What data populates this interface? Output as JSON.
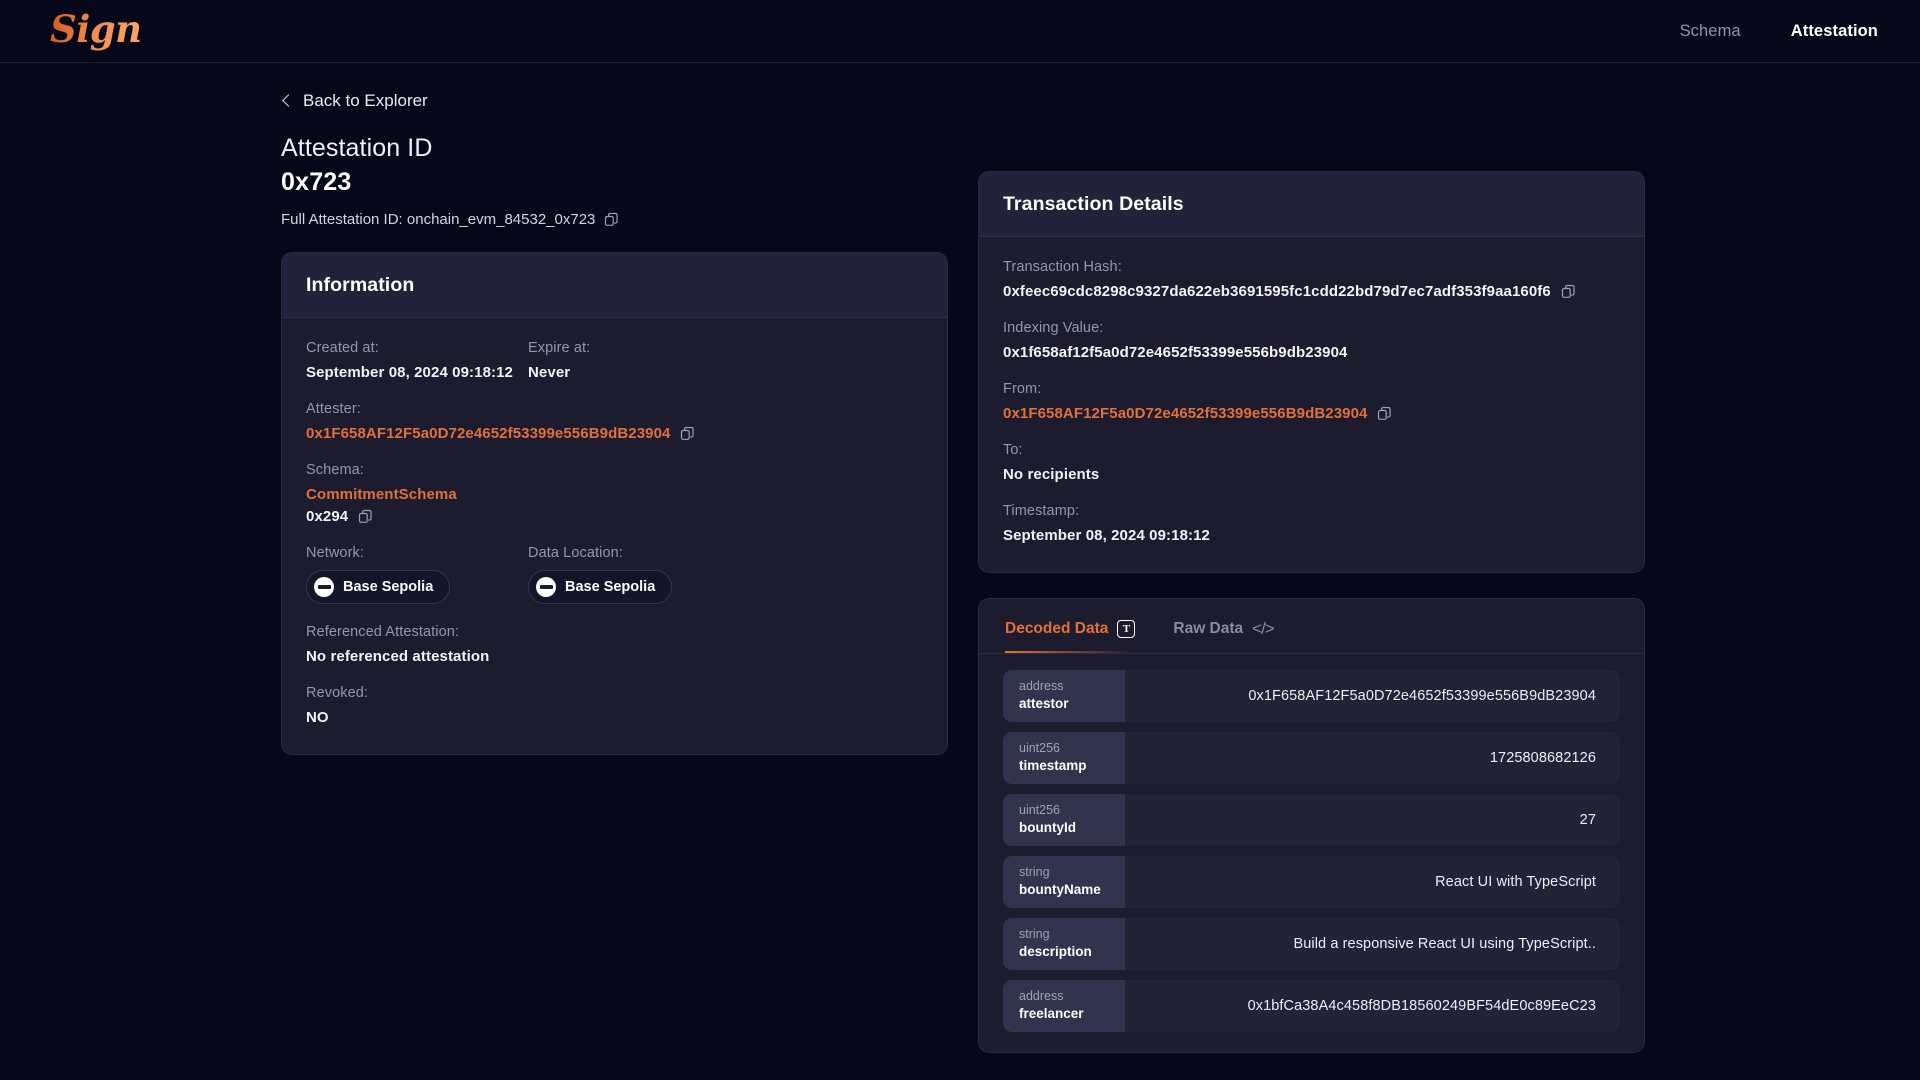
{
  "header": {
    "logo_text": "Sign",
    "nav": [
      {
        "label": "Schema",
        "active": false
      },
      {
        "label": "Attestation",
        "active": true
      }
    ]
  },
  "back_link": {
    "label": "Back to Explorer",
    "icon": "chevron-left-icon"
  },
  "attestation": {
    "title": "Attestation ID",
    "id": "0x723",
    "full_id_label": "Full Attestation ID: onchain_evm_84532_0x723",
    "copy_icon": "copy-icon"
  },
  "information": {
    "title": "Information",
    "created_at": {
      "label": "Created at:",
      "value": "September 08, 2024 09:18:12"
    },
    "expire_at": {
      "label": "Expire at:",
      "value": "Never"
    },
    "attester": {
      "label": "Attester:",
      "value": "0x1F658AF12F5a0D72e4652f53399e556B9dB23904"
    },
    "schema": {
      "label": "Schema:",
      "name": "CommitmentSchema",
      "id": "0x294"
    },
    "network": {
      "label": "Network:",
      "value": "Base Sepolia"
    },
    "data_location": {
      "label": "Data Location:",
      "value": "Base Sepolia"
    },
    "referenced_attestation": {
      "label": "Referenced Attestation:",
      "value": "No referenced attestation"
    },
    "revoked": {
      "label": "Revoked:",
      "value": "NO"
    }
  },
  "transaction": {
    "title": "Transaction Details",
    "tx_hash": {
      "label": "Transaction Hash:",
      "value": "0xfeec69cdc8298c9327da622eb3691595fc1cdd22bd79d7ec7adf353f9aa160f6"
    },
    "indexing_value": {
      "label": "Indexing Value:",
      "value": "0x1f658af12f5a0d72e4652f53399e556b9db23904"
    },
    "from": {
      "label": "From:",
      "value": "0x1F658AF12F5a0D72e4652f53399e556B9dB23904"
    },
    "to": {
      "label": "To:",
      "value": "No recipients"
    },
    "timestamp": {
      "label": "Timestamp:",
      "value": "September 08, 2024 09:18:12"
    }
  },
  "data_panel": {
    "tabs": [
      {
        "label": "Decoded Data",
        "icon": "text-format-icon",
        "active": true
      },
      {
        "label": "Raw Data",
        "icon": "code-brackets-icon",
        "active": false
      }
    ],
    "rows": [
      {
        "type": "address",
        "name": "attestor",
        "value": "0x1F658AF12F5a0D72e4652f53399e556B9dB23904"
      },
      {
        "type": "uint256",
        "name": "timestamp",
        "value": "1725808682126"
      },
      {
        "type": "uint256",
        "name": "bountyId",
        "value": "27"
      },
      {
        "type": "string",
        "name": "bountyName",
        "value": "React UI with TypeScript"
      },
      {
        "type": "string",
        "name": "description",
        "value": "Build a responsive React UI using TypeScript.."
      },
      {
        "type": "address",
        "name": "freelancer",
        "value": "0x1bfCa38A4c458f8DB18560249BF54dE0c89EeC23"
      }
    ]
  },
  "colors": {
    "page_bg": "#07071a",
    "card_bg": "#1c1c2e",
    "accent": "#e2703a",
    "muted_text": "#9397ad"
  }
}
